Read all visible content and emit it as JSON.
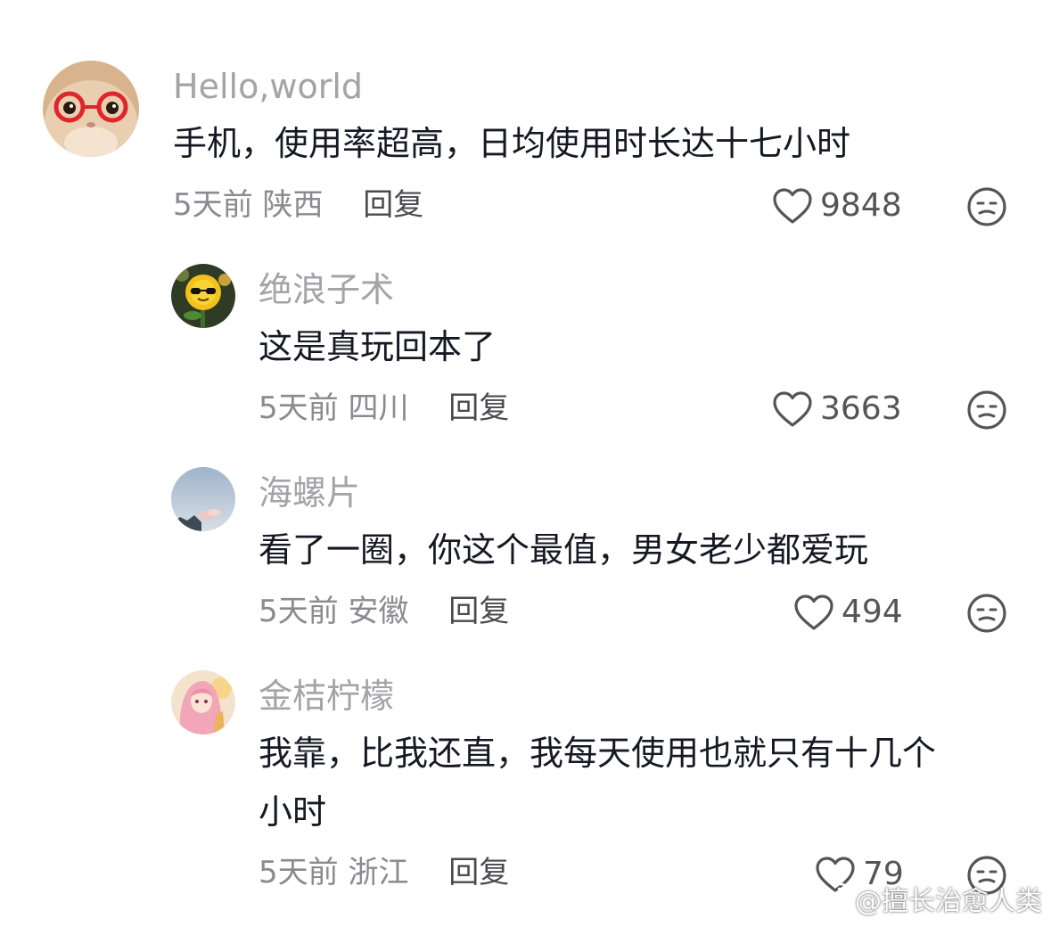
{
  "comments": [
    {
      "username": "Hello,world",
      "content": "手机，使用率超高，日均使用时长达十七小时",
      "time": "5天前",
      "location": "陕西",
      "reply_label": "回复",
      "likes": "9848",
      "avatar": "cat-with-red-glasses"
    },
    {
      "username": "绝浪子术",
      "content": "这是真玩回本了",
      "time": "5天前",
      "location": "四川",
      "reply_label": "回复",
      "likes": "3663",
      "avatar": "sunflower-with-sunglasses"
    },
    {
      "username": "海螺片",
      "content": "看了一圈，你这个最值，男女老少都爱玩",
      "time": "5天前",
      "location": "安徽",
      "reply_label": "回复",
      "likes": "494",
      "avatar": "sky-landscape"
    },
    {
      "username": "金桔柠檬",
      "content": "我靠，比我还直，我每天使用也就只有十几个\n小时",
      "time": "5天前",
      "location": "浙江",
      "reply_label": "回复",
      "likes": "79",
      "avatar": "anime-girl-pink"
    }
  ],
  "watermark": "@擅长治愈人类",
  "icons": {
    "like": "heart-outline-icon",
    "dislike": "unhappy-face-icon",
    "watermark_logo": "weibo-logo-icon"
  },
  "colors": {
    "username": "#a3a3a8",
    "content": "#161823",
    "meta": "#8a8a90",
    "reply": "#4a4a50"
  }
}
